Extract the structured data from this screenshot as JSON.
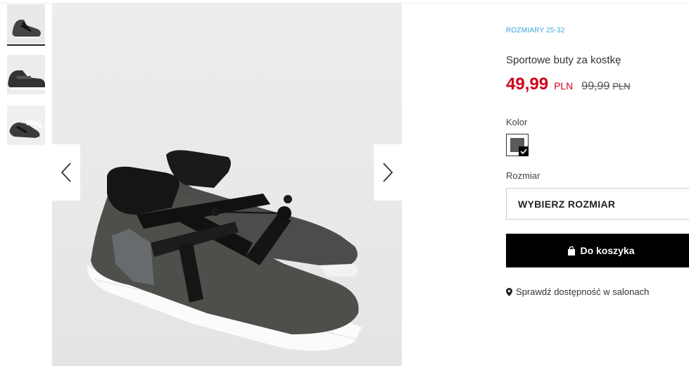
{
  "product": {
    "size_range": "ROZMIARY 25-32",
    "title": "Sportowe buty za kostkę",
    "price_current": "49,99",
    "price_current_currency": "PLN",
    "price_old": "99,99",
    "price_old_currency": "PLN"
  },
  "color": {
    "label": "Kolor",
    "selected_swatch": "#5a5a5a"
  },
  "size": {
    "label": "Rozmiar",
    "select_text": "WYBIERZ ROZMIAR"
  },
  "cart": {
    "button_label": "Do koszyka"
  },
  "availability": {
    "link_text": "Sprawdź dostępność w salonach"
  },
  "colors": {
    "price_red": "#d0021b",
    "size_range_blue": "#3aa6d8",
    "button_bg": "#000000"
  }
}
